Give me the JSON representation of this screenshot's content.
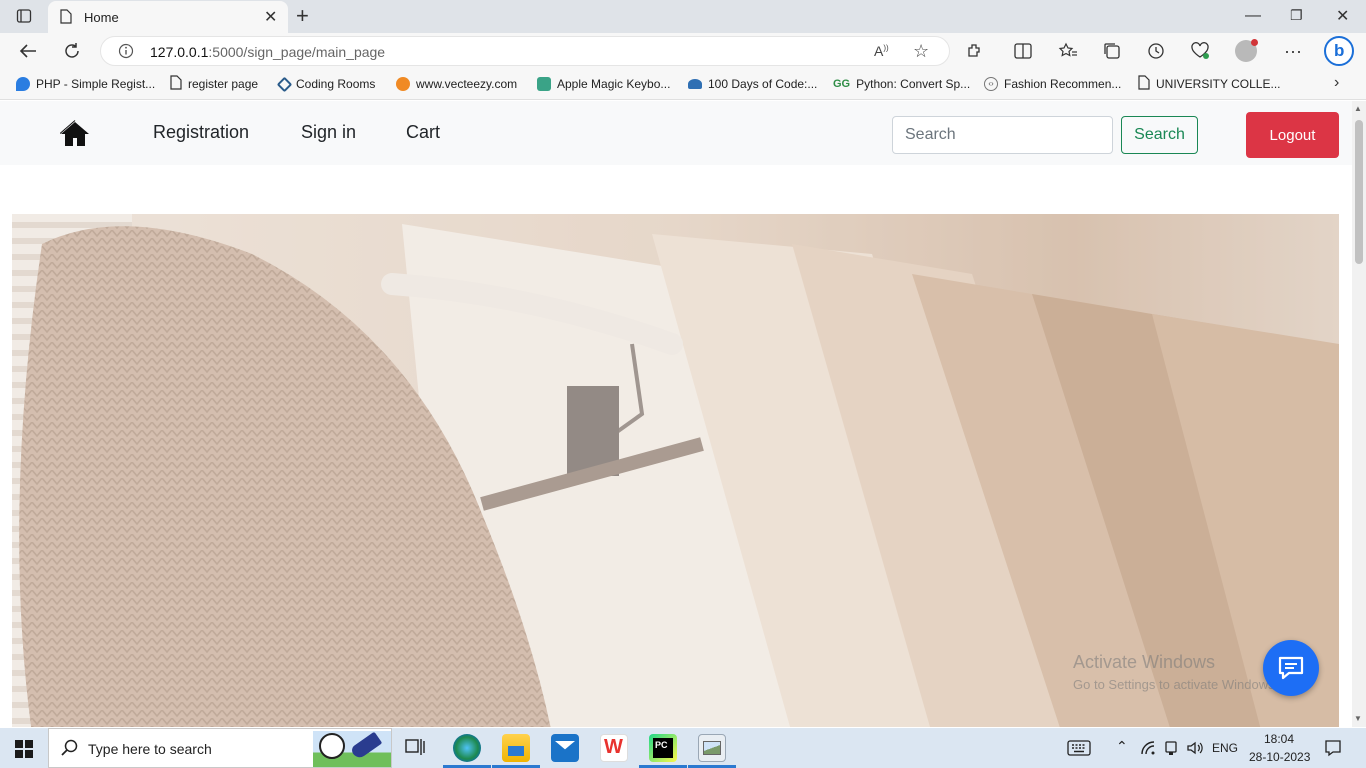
{
  "browser": {
    "tab_title": "Home",
    "new_tab_glyph": "+",
    "url_host": "127.0.0.1",
    "url_path": ":5000/sign_page/main_page",
    "bookmarks": [
      {
        "label": "PHP - Simple Regist...",
        "icon": "php-icon"
      },
      {
        "label": "register page",
        "icon": "page-icon"
      },
      {
        "label": "Coding Rooms",
        "icon": "coding-rooms-icon"
      },
      {
        "label": "www.vecteezy.com",
        "icon": "vecteezy-icon"
      },
      {
        "label": "Apple Magic Keybo...",
        "icon": "apple-magic-icon"
      },
      {
        "label": "100 Days of Code:...",
        "icon": "tata-icon"
      },
      {
        "label": "Python: Convert Sp...",
        "icon": "gfg-icon"
      },
      {
        "label": "Fashion Recommen...",
        "icon": "code-icon"
      },
      {
        "label": "UNIVERSITY COLLE...",
        "icon": "page-icon"
      }
    ]
  },
  "navbar": {
    "links": [
      "Registration",
      "Sign in",
      "Cart"
    ],
    "search_placeholder": "Search",
    "search_button": "Search",
    "logout_button": "Logout"
  },
  "watermark": {
    "line1": "Activate Windows",
    "line2": "Go to Settings to activate Windows."
  },
  "taskbar": {
    "search_placeholder": "Type here to search",
    "language": "ENG",
    "time": "18:04",
    "date": "28-10-2023"
  },
  "colors": {
    "logout": "#dc3545",
    "search_outline": "#198754",
    "chat_button": "#1d6ef5",
    "navbar_bg": "#f8f9fa"
  }
}
